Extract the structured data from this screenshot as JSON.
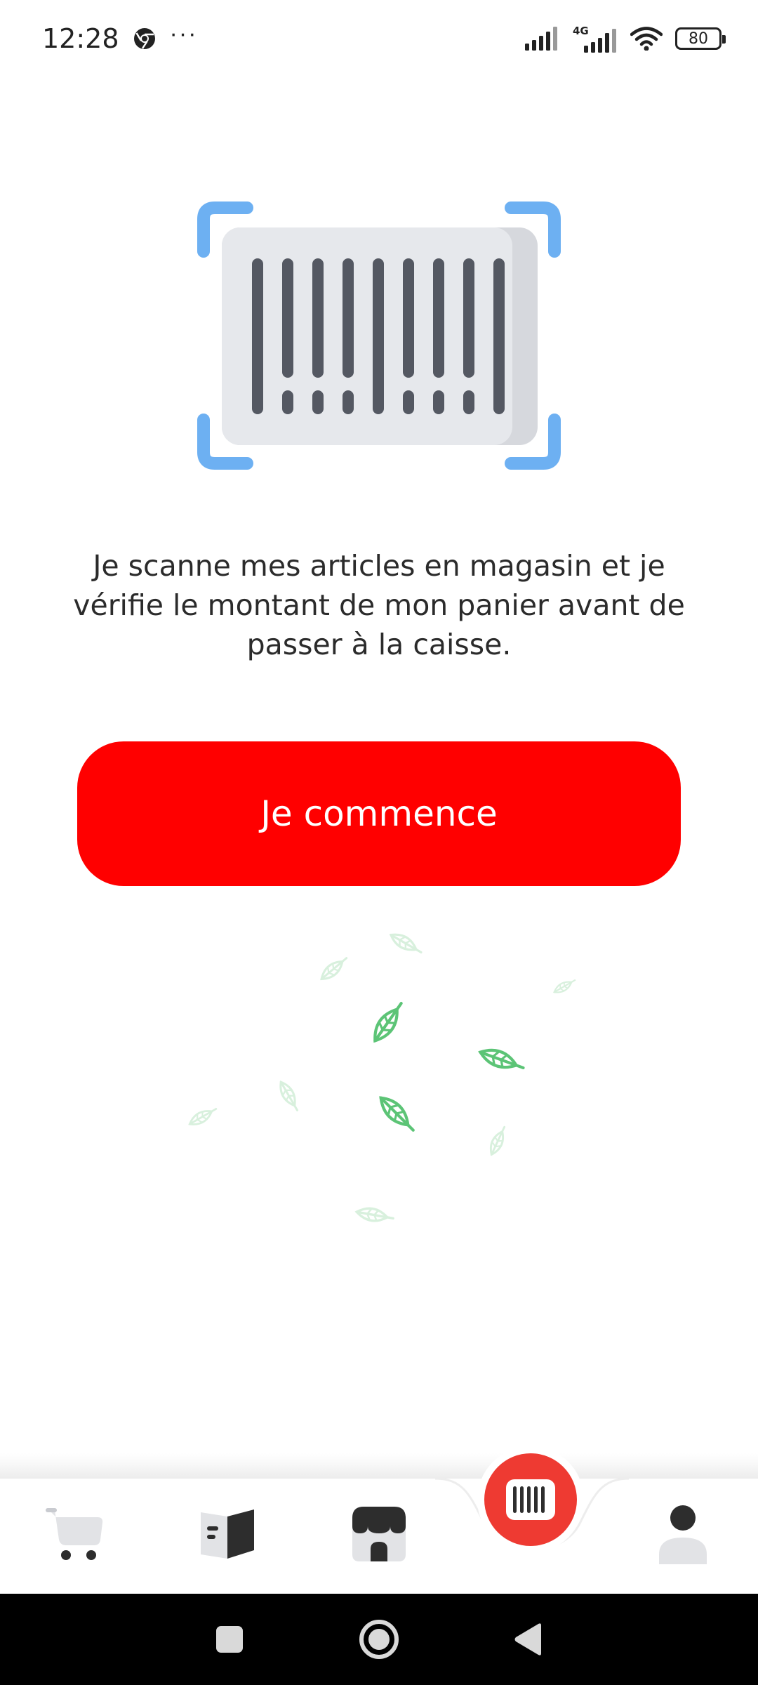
{
  "status_bar": {
    "time": "12:28",
    "dots": "···",
    "battery_level": "80",
    "network_type": "4G"
  },
  "main": {
    "description": "Je scanne mes articles en magasin et je vérifie le montant de mon panier avant de passer à la caisse.",
    "start_button_label": "Je commence"
  },
  "bottom_nav": {
    "items": [
      {
        "icon": "cart-icon"
      },
      {
        "icon": "catalog-icon"
      },
      {
        "icon": "store-icon"
      },
      {
        "icon": "barcode-scan-icon",
        "active": true
      },
      {
        "icon": "profile-icon"
      }
    ]
  },
  "colors": {
    "accent_red": "#ff0000",
    "scan_red": "#ee3a32",
    "frame_blue": "#6db0f2",
    "leaf_green": "#5cc476",
    "icon_gray": "#2d2d2d"
  }
}
